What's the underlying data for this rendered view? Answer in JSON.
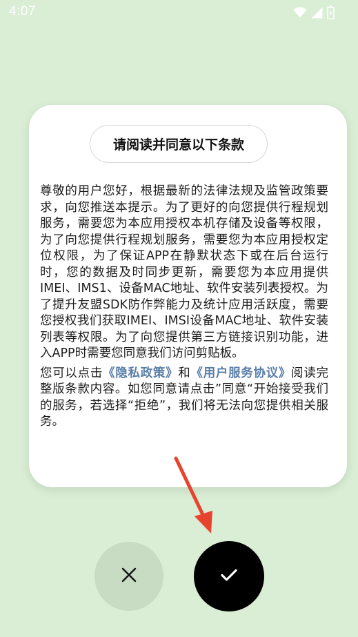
{
  "status_bar": {
    "time": "4:07",
    "icons": [
      "wifi-icon",
      "signal-icon",
      "battery-icon"
    ]
  },
  "dialog": {
    "title": "请阅读并同意以下条款",
    "paragraph1": "尊敬的用户您好，根据最新的法律法规及监管政策要求，向您推送本提示。为了更好的向您提供行程规划服务，需要您为本应用授权本机存储及设备等权限，为了向您提供行程规划服务，需要您为本应用授权定位权限，为了保证APP在静默状态下或在后台运行时，您的数据及时同步更新，需要您为本应用提供IMEI、IMS1、设备MAC地址、软件安装列表授权。为了提升友盟SDK防作弊能力及统计应用活跃度，需要您授权我们获取IMEI、IMSI设备MAC地址、软件安装列表等权限。为了向您提供第三方链接识别功能，进入APP时需要您同意我们访问剪贴板。",
    "paragraph2_prefix": "您可以点击",
    "privacy_policy_link": "《隐私政策》",
    "paragraph2_and": "和",
    "user_agreement_link": "《用户服务协议》",
    "paragraph2_suffix": "阅读完整版条款内容。如您同意请点击”同意“开始接受我们的服务，若选择“拒绝”，我们将无法向您提供相关服务。"
  },
  "actions": {
    "reject_icon": "close-icon",
    "accept_icon": "check-icon"
  },
  "colors": {
    "background": "#d9eed5",
    "reject_button": "#c7dcc3",
    "accept_button": "#000000",
    "link": "#5a7fa8",
    "annotation_arrow": "#e8432d"
  }
}
